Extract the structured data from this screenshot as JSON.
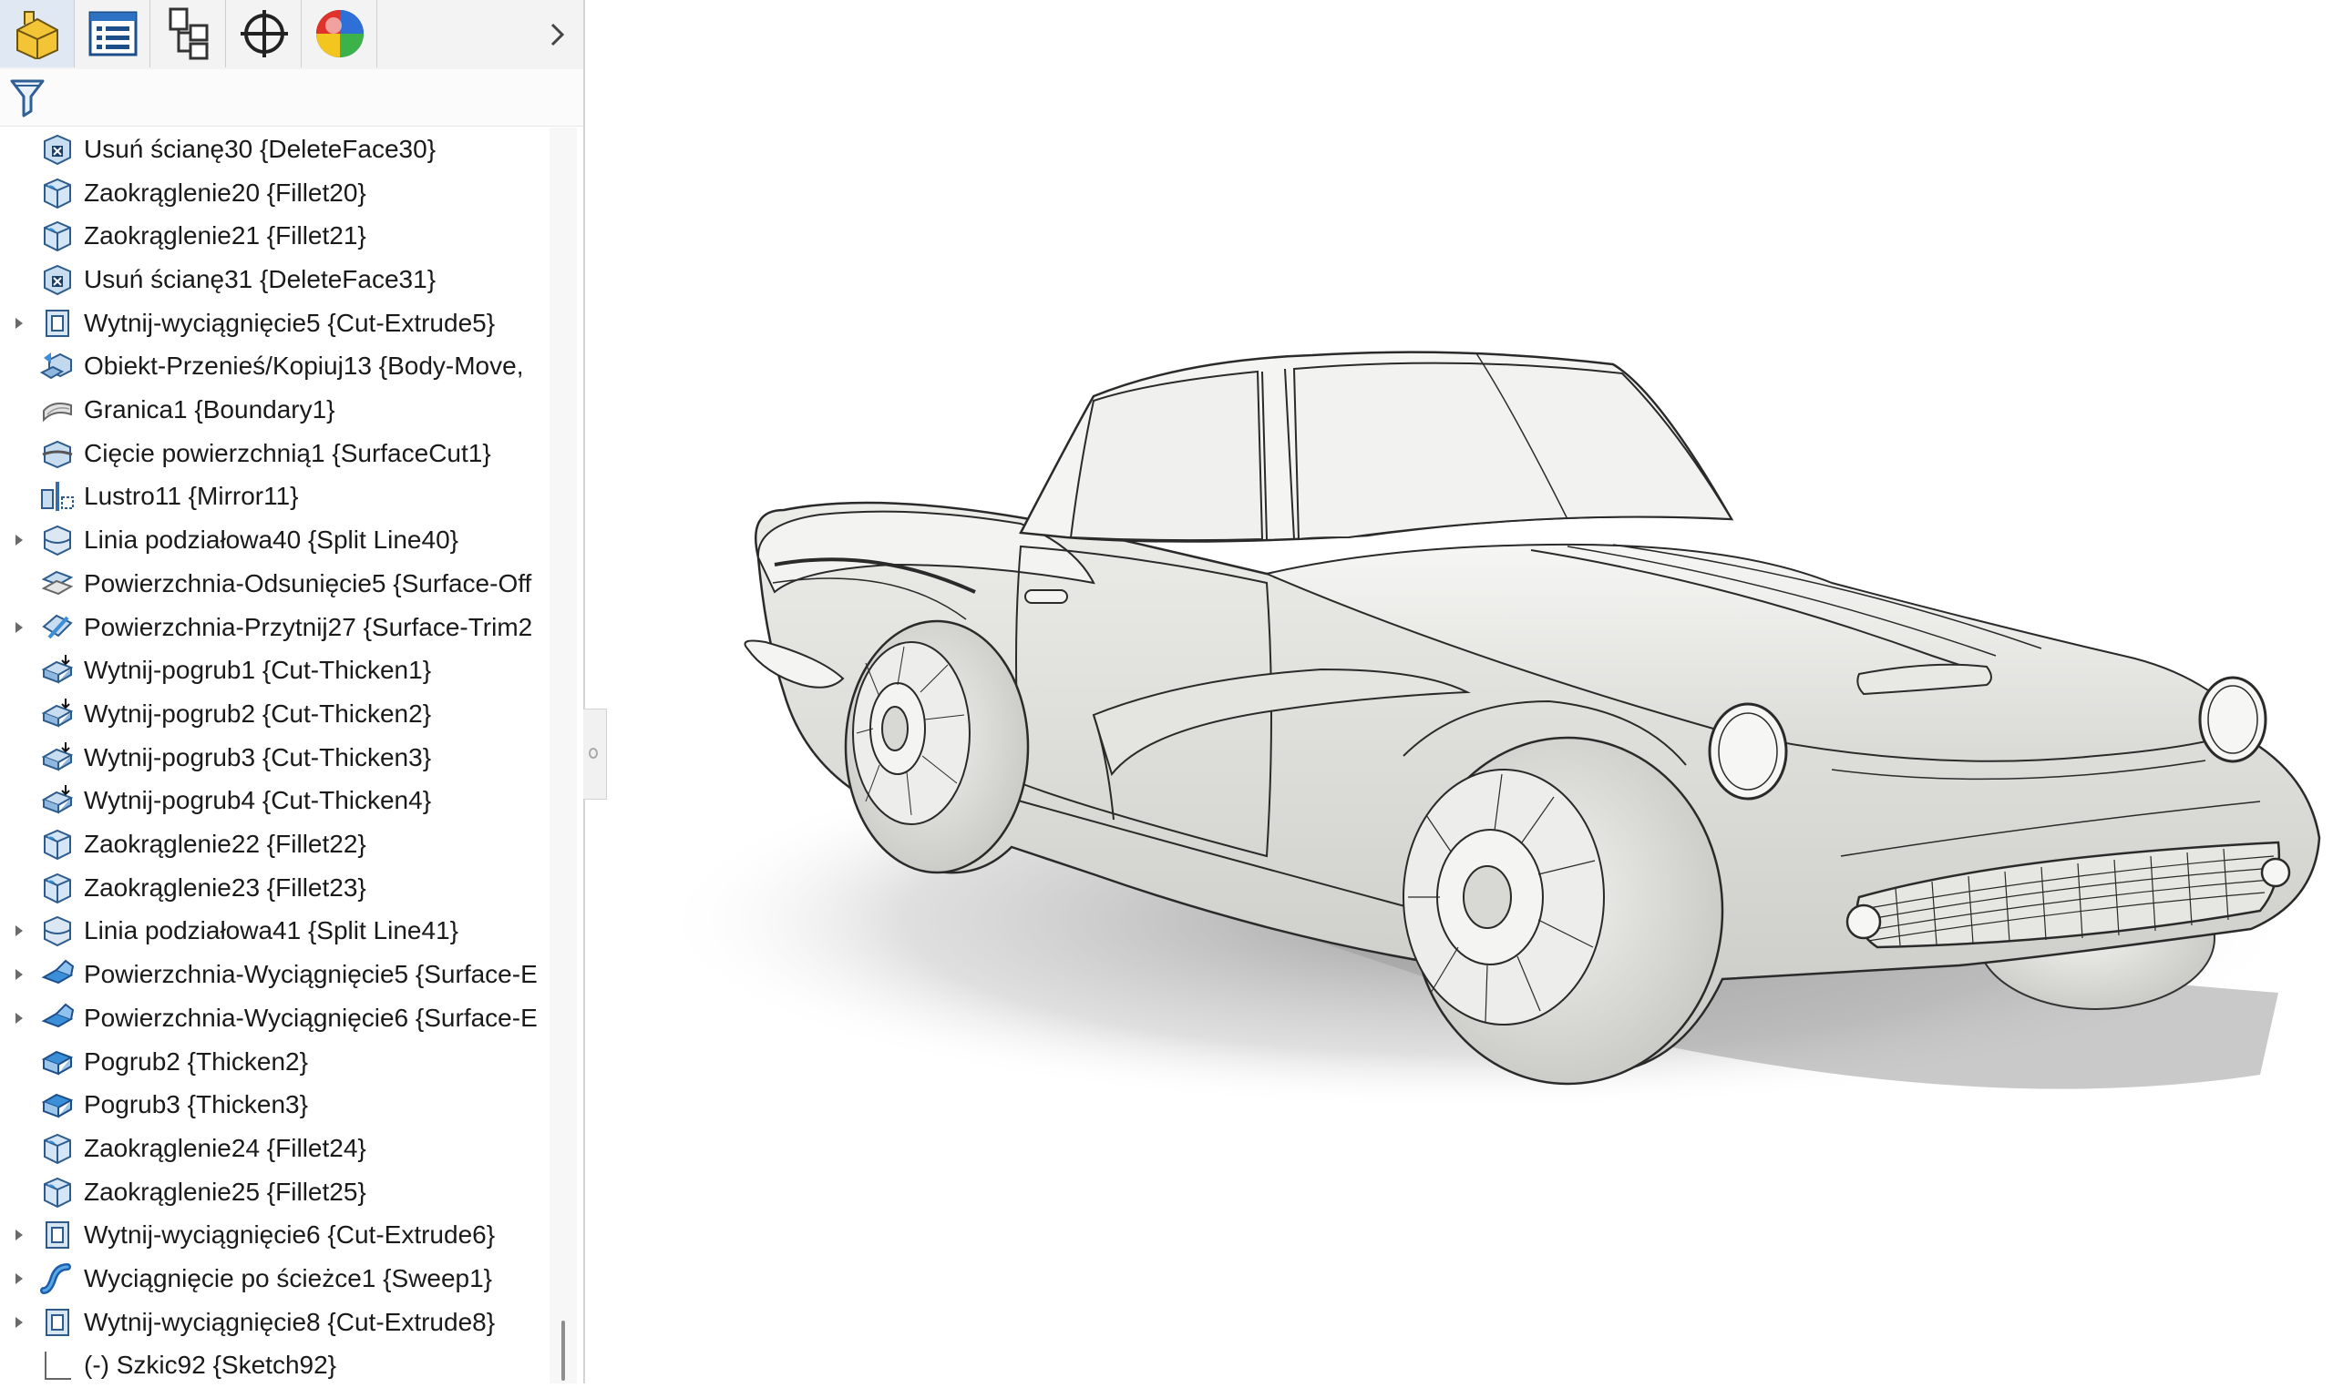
{
  "panel": {
    "tabs": [
      {
        "name": "feature-manager-tab",
        "icon": "part-icon"
      },
      {
        "name": "property-manager-tab",
        "icon": "property-list-icon"
      },
      {
        "name": "configuration-manager-tab",
        "icon": "configuration-icon"
      },
      {
        "name": "dimxpert-manager-tab",
        "icon": "crosshair-icon"
      },
      {
        "name": "display-manager-tab",
        "icon": "appearance-sphere-icon"
      }
    ],
    "more_icon": "chevron-right-icon",
    "filter_icon": "filter-icon"
  },
  "tree": {
    "items": [
      {
        "label": "Usuń ścianę30 {DeleteFace30}",
        "icon": "delete-face-icon",
        "expandable": false
      },
      {
        "label": "Zaokrąglenie20 {Fillet20}",
        "icon": "fillet-icon",
        "expandable": false
      },
      {
        "label": "Zaokrąglenie21 {Fillet21}",
        "icon": "fillet-icon",
        "expandable": false
      },
      {
        "label": "Usuń ścianę31 {DeleteFace31}",
        "icon": "delete-face-icon",
        "expandable": false
      },
      {
        "label": "Wytnij-wyciągnięcie5 {Cut-Extrude5}",
        "icon": "cut-extrude-icon",
        "expandable": true
      },
      {
        "label": "Obiekt-Przenieś/Kopiuj13 {Body-Move,",
        "icon": "move-copy-body-icon",
        "expandable": false
      },
      {
        "label": "Granica1 {Boundary1}",
        "icon": "boundary-icon",
        "expandable": false
      },
      {
        "label": "Cięcie powierzchnią1 {SurfaceCut1}",
        "icon": "surface-cut-icon",
        "expandable": false
      },
      {
        "label": "Lustro11 {Mirror11}",
        "icon": "mirror-icon",
        "expandable": false
      },
      {
        "label": "Linia podziałowa40 {Split Line40}",
        "icon": "split-line-icon",
        "expandable": true
      },
      {
        "label": "Powierzchnia-Odsunięcie5 {Surface-Off",
        "icon": "surface-offset-icon",
        "expandable": false
      },
      {
        "label": "Powierzchnia-Przytnij27 {Surface-Trim2",
        "icon": "surface-trim-icon",
        "expandable": true
      },
      {
        "label": "Wytnij-pogrub1 {Cut-Thicken1}",
        "icon": "cut-thicken-icon",
        "expandable": false
      },
      {
        "label": "Wytnij-pogrub2 {Cut-Thicken2}",
        "icon": "cut-thicken-icon",
        "expandable": false
      },
      {
        "label": "Wytnij-pogrub3 {Cut-Thicken3}",
        "icon": "cut-thicken-icon",
        "expandable": false
      },
      {
        "label": "Wytnij-pogrub4 {Cut-Thicken4}",
        "icon": "cut-thicken-icon",
        "expandable": false
      },
      {
        "label": "Zaokrąglenie22 {Fillet22}",
        "icon": "fillet-icon",
        "expandable": false
      },
      {
        "label": "Zaokrąglenie23 {Fillet23}",
        "icon": "fillet-icon",
        "expandable": false
      },
      {
        "label": "Linia podziałowa41 {Split Line41}",
        "icon": "split-line-icon",
        "expandable": true
      },
      {
        "label": "Powierzchnia-Wyciągnięcie5 {Surface-E",
        "icon": "surface-extrude-icon",
        "expandable": true
      },
      {
        "label": "Powierzchnia-Wyciągnięcie6 {Surface-E",
        "icon": "surface-extrude-icon",
        "expandable": true
      },
      {
        "label": "Pogrub2 {Thicken2}",
        "icon": "thicken-icon",
        "expandable": false
      },
      {
        "label": "Pogrub3 {Thicken3}",
        "icon": "thicken-icon",
        "expandable": false
      },
      {
        "label": "Zaokrąglenie24 {Fillet24}",
        "icon": "fillet-icon",
        "expandable": false
      },
      {
        "label": "Zaokrąglenie25 {Fillet25}",
        "icon": "fillet-icon",
        "expandable": false
      },
      {
        "label": "Wytnij-wyciągnięcie6 {Cut-Extrude6}",
        "icon": "cut-extrude-icon",
        "expandable": true
      },
      {
        "label": "Wyciągnięcie po ścieżce1 {Sweep1}",
        "icon": "sweep-icon",
        "expandable": true
      },
      {
        "label": "Wytnij-wyciągnięcie8 {Cut-Extrude8}",
        "icon": "cut-extrude-icon",
        "expandable": true
      },
      {
        "label": "(-) Szkic92 {Sketch92}",
        "icon": "sketch-icon",
        "expandable": false
      }
    ]
  },
  "viewport": {
    "model": "car-body-model",
    "colors": {
      "model": "#ececea",
      "edges": "#2a2a2a",
      "shadow": "#9a9a9a",
      "background": "#ffffff"
    }
  },
  "colors": {
    "accent_blue": "#3a8fd8",
    "icon_yellow": "#f2c230"
  }
}
